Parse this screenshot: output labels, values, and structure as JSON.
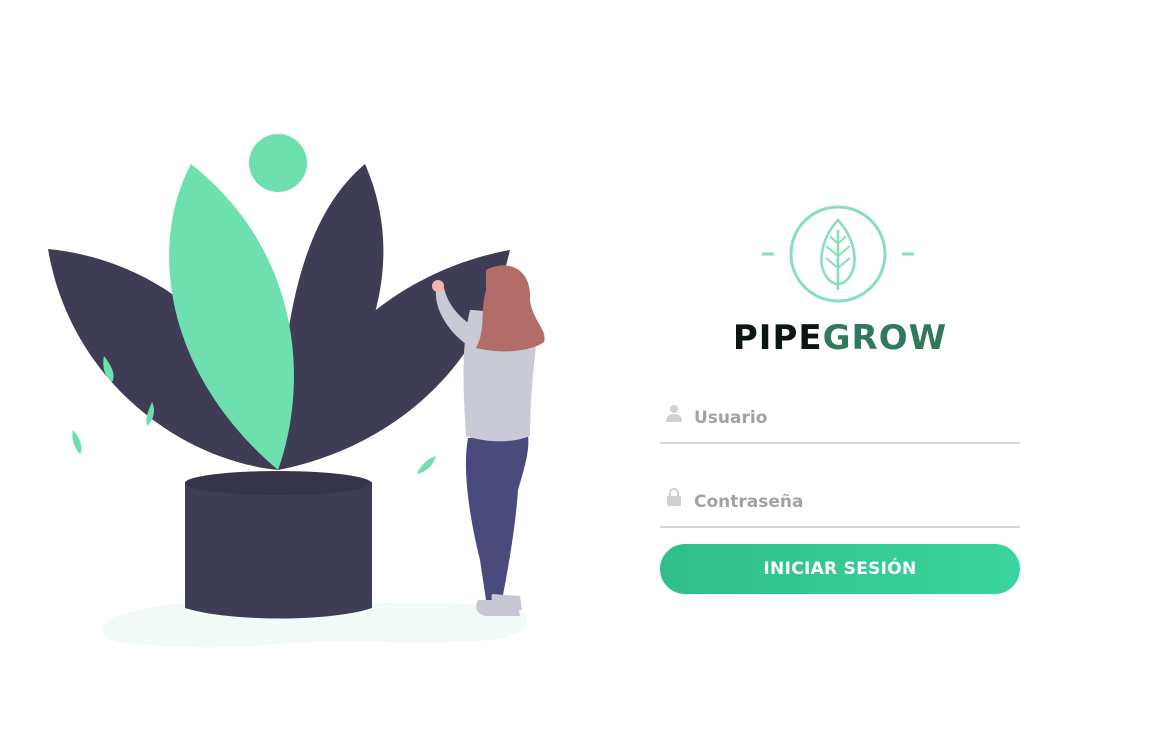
{
  "brand": {
    "part1": "PIPE",
    "part2": "GROW",
    "icon": "leaf-icon"
  },
  "form": {
    "username": {
      "placeholder": "Usuario",
      "value": "",
      "icon": "user-icon"
    },
    "password": {
      "placeholder": "Contraseña",
      "value": "",
      "icon": "lock-icon"
    },
    "submit_label": "INICIAR SESIÓN"
  },
  "colors": {
    "accent": "#38d39f",
    "accent_dark": "#2f7a5c",
    "brand_dark": "#0c1614",
    "plant_dark": "#3f3d56",
    "plant_light": "#6ee0b0"
  }
}
